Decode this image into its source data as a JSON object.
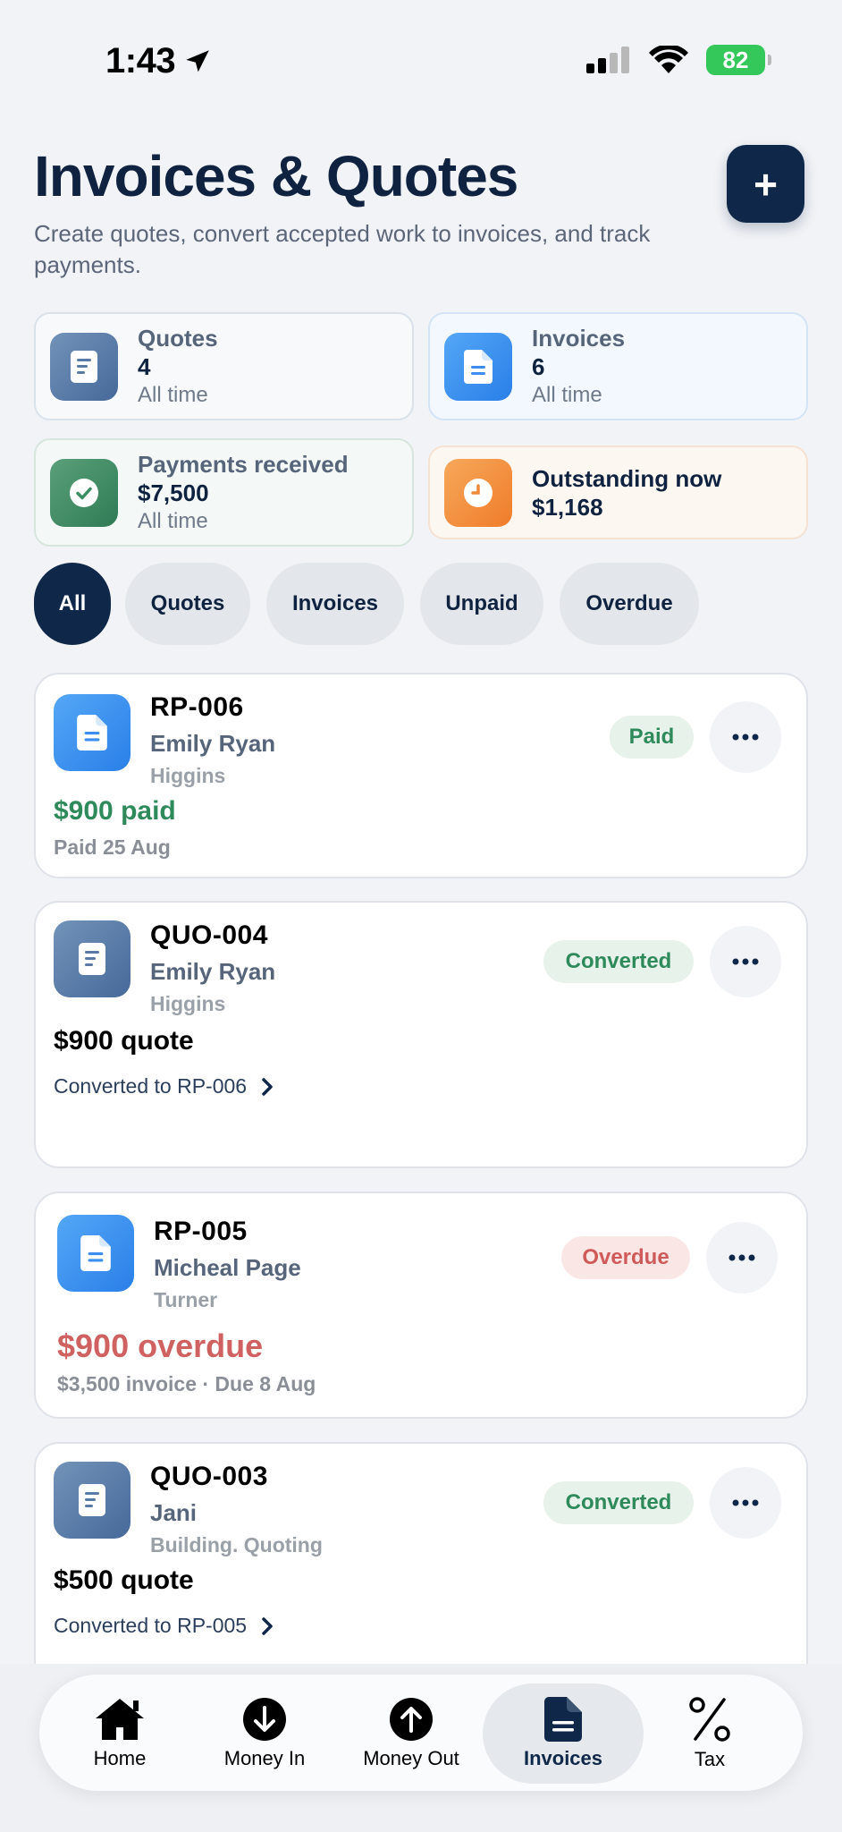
{
  "status_bar": {
    "time": "1:43",
    "battery": "82"
  },
  "header": {
    "title": "Invoices & Quotes",
    "subtitle": "Create quotes, convert accepted work to invoices, and track payments.",
    "add_label": "+"
  },
  "stats": {
    "quotes": {
      "label": "Quotes",
      "value": "4",
      "sub": "All time"
    },
    "invoices": {
      "label": "Invoices",
      "value": "6",
      "sub": "All time"
    },
    "payments": {
      "label": "Payments received",
      "value": "$7,500",
      "sub": "All time"
    },
    "outstanding": {
      "label": "Outstanding now",
      "value": "$1,168"
    }
  },
  "filters": [
    "All",
    "Quotes",
    "Invoices",
    "Unpaid",
    "Overdue"
  ],
  "documents": [
    {
      "number": "RP-006",
      "client": "Emily Ryan",
      "project": "Higgins",
      "status": "Paid",
      "amount": "$900 paid",
      "meta": "Paid 25 Aug"
    },
    {
      "number": "QUO-004",
      "client": "Emily Ryan",
      "project": "Higgins",
      "status": "Converted",
      "amount": "$900 quote",
      "link": "Converted to RP-006"
    },
    {
      "number": "RP-005",
      "client": "Micheal Page",
      "project": "Turner",
      "status": "Overdue",
      "amount": "$900 overdue",
      "meta": "$3,500 invoice · Due 8 Aug"
    },
    {
      "number": "QUO-003",
      "client": "Jani",
      "project": "Building. Quoting",
      "status": "Converted",
      "amount": "$500 quote",
      "link": "Converted to RP-005"
    }
  ],
  "nav": [
    "Home",
    "Money In",
    "Money Out",
    "Invoices",
    "Tax"
  ],
  "colors": {
    "navy": "#0f2748",
    "green": "#2e8a5b",
    "red": "#d06161",
    "accent_blue": "#2a7fe8",
    "orange": "#ef7c2a"
  },
  "icons": {
    "quote": "quote-doc-icon",
    "invoice": "invoice-doc-icon",
    "payments": "check-circle-icon",
    "outstanding": "clock-icon",
    "more": "ellipsis-icon"
  }
}
